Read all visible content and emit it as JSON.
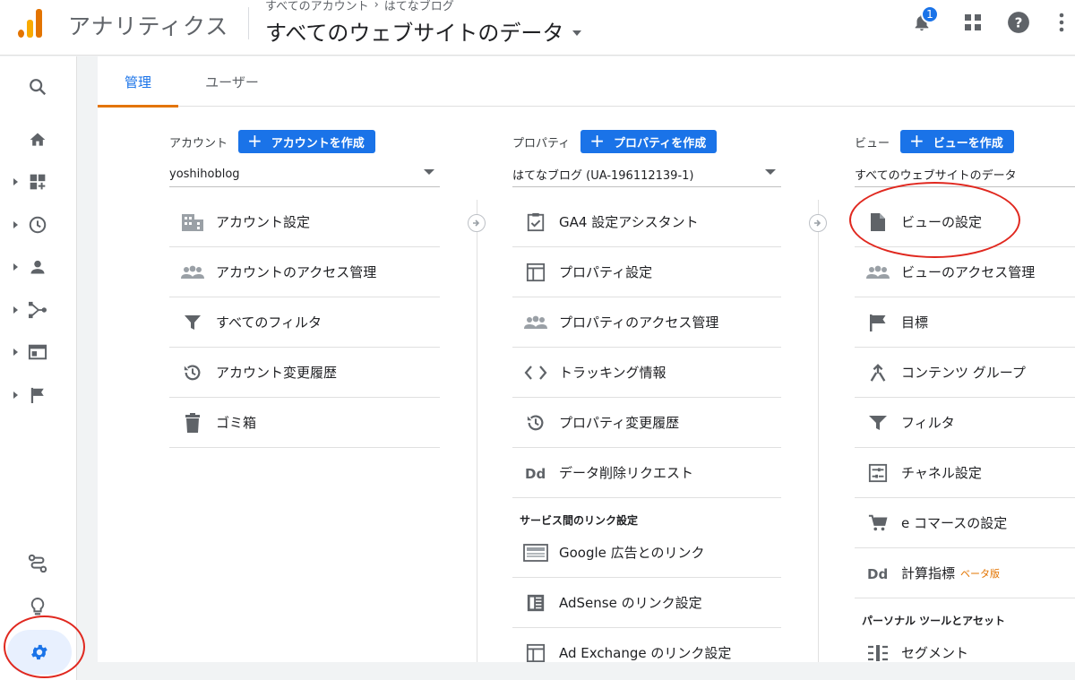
{
  "header": {
    "app_name": "アナリティクス",
    "breadcrumb_account": "すべてのアカウント",
    "breadcrumb_sep": "›",
    "breadcrumb_property": "はてなブログ",
    "property_title": "すべてのウェブサイトのデータ",
    "notification_count": "1"
  },
  "tabs": [
    {
      "label": "管理"
    },
    {
      "label": "ユーザー"
    }
  ],
  "account": {
    "label": "アカウント",
    "create_label": "アカウントを作成",
    "selected": "yoshihoblog",
    "items": [
      {
        "label": "アカウント設定",
        "icon": "building-icon"
      },
      {
        "label": "アカウントのアクセス管理",
        "icon": "people-icon"
      },
      {
        "label": "すべてのフィルタ",
        "icon": "filter-icon"
      },
      {
        "label": "アカウント変更履歴",
        "icon": "history-icon"
      },
      {
        "label": "ゴミ箱",
        "icon": "trash-icon"
      }
    ]
  },
  "property": {
    "label": "プロパティ",
    "create_label": "プロパティを作成",
    "selected": "はてなブログ (UA-196112139-1)",
    "items": [
      {
        "label": "GA4 設定アシスタント",
        "icon": "checkbox-icon"
      },
      {
        "label": "プロパティ設定",
        "icon": "layout-icon"
      },
      {
        "label": "プロパティのアクセス管理",
        "icon": "people-icon"
      },
      {
        "label": "トラッキング情報",
        "icon": "code-icon"
      },
      {
        "label": "プロパティ変更履歴",
        "icon": "history-icon"
      },
      {
        "label": "データ削除リクエスト",
        "icon": "dd-icon"
      }
    ],
    "section_label": "サービス間のリンク設定",
    "link_items": [
      {
        "label": "Google 広告とのリンク",
        "icon": "ads-icon"
      },
      {
        "label": "AdSense のリンク設定",
        "icon": "adsense-icon"
      },
      {
        "label": "Ad Exchange のリンク設定",
        "icon": "adexchange-icon"
      }
    ]
  },
  "view": {
    "label": "ビュー",
    "create_label": "ビューを作成",
    "selected": "すべてのウェブサイトのデータ",
    "items": [
      {
        "label": "ビューの設定",
        "icon": "document-icon"
      },
      {
        "label": "ビューのアクセス管理",
        "icon": "people-icon"
      },
      {
        "label": "目標",
        "icon": "flag-icon"
      },
      {
        "label": "コンテンツ グループ",
        "icon": "content-group-icon"
      },
      {
        "label": "フィルタ",
        "icon": "filter-icon"
      },
      {
        "label": "チャネル設定",
        "icon": "channel-icon"
      },
      {
        "label": "e コマースの設定",
        "icon": "cart-icon"
      },
      {
        "label": "計算指標",
        "icon": "dd-icon"
      }
    ],
    "beta_label": "ベータ版",
    "section_label": "パーソナル ツールとアセット",
    "personal_items": [
      {
        "label": "セグメント",
        "icon": "segment-icon"
      }
    ]
  },
  "colors": {
    "accent": "#1a73e8",
    "tab_indicator": "#e37400",
    "annotation": "#e0281f"
  }
}
